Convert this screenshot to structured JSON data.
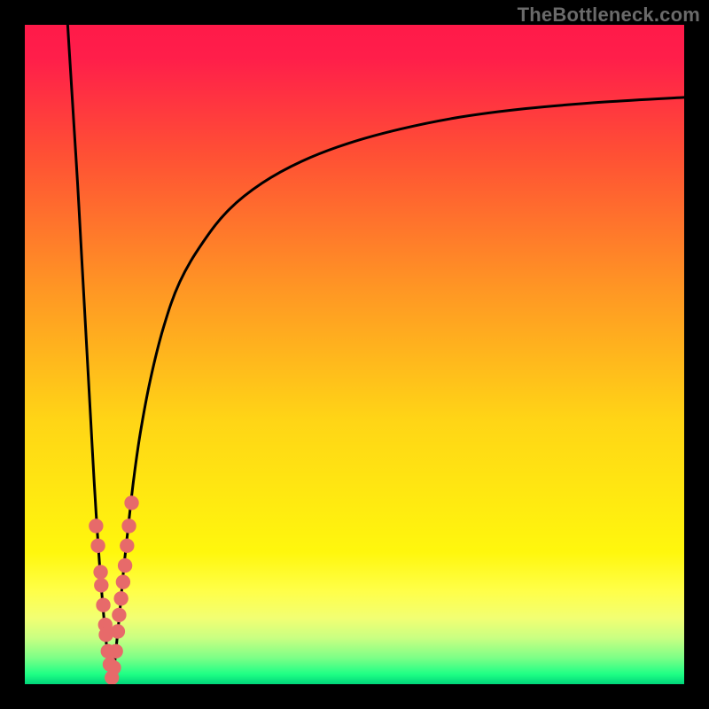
{
  "watermark": "TheBottleneck.com",
  "chart_data": {
    "type": "line",
    "title": "",
    "xlabel": "",
    "ylabel": "",
    "xlim": [
      0,
      100
    ],
    "ylim": [
      0,
      100
    ],
    "grid": false,
    "legend": false,
    "background": {
      "type": "vertical-gradient",
      "stops": [
        {
          "pos": 0.0,
          "color": "#ff1a49"
        },
        {
          "pos": 0.05,
          "color": "#ff1e4a"
        },
        {
          "pos": 0.2,
          "color": "#ff5134"
        },
        {
          "pos": 0.4,
          "color": "#ff9624"
        },
        {
          "pos": 0.6,
          "color": "#ffd516"
        },
        {
          "pos": 0.8,
          "color": "#fff70d"
        },
        {
          "pos": 0.86,
          "color": "#ffff4a"
        },
        {
          "pos": 0.9,
          "color": "#f2ff73"
        },
        {
          "pos": 0.93,
          "color": "#c9ff82"
        },
        {
          "pos": 0.96,
          "color": "#7dff87"
        },
        {
          "pos": 0.985,
          "color": "#1eff85"
        },
        {
          "pos": 1.0,
          "color": "#00d47a"
        }
      ]
    },
    "series": [
      {
        "name": "left-branch",
        "color": "#000000",
        "x": [
          6.5,
          7.0,
          7.5,
          8.0,
          8.5,
          9.0,
          9.5,
          10.0,
          10.5,
          11.0,
          11.5,
          12.0,
          12.5,
          13.0,
          13.2
        ],
        "y": [
          100,
          92,
          84,
          76,
          67,
          58,
          49,
          40,
          31,
          23,
          16,
          10,
          5,
          1.5,
          0.5
        ]
      },
      {
        "name": "right-branch",
        "color": "#000000",
        "x": [
          13.2,
          13.6,
          14.0,
          14.5,
          15.0,
          15.7,
          16.5,
          17.5,
          19.0,
          21.0,
          23.5,
          27.0,
          31.0,
          36.0,
          42.0,
          49.0,
          57.0,
          66.0,
          76.0,
          88.0,
          100.0
        ],
        "y": [
          0.5,
          3.0,
          7.0,
          12.0,
          17.5,
          24.0,
          31.0,
          38.0,
          46.0,
          54.0,
          61.0,
          67.0,
          72.0,
          76.0,
          79.3,
          82.0,
          84.2,
          86.0,
          87.3,
          88.3,
          89.0
        ]
      }
    ],
    "scatter": {
      "name": "marker-dots",
      "color": "#e76a6a",
      "radius": 1.1,
      "points": [
        {
          "x": 10.8,
          "y": 24.0
        },
        {
          "x": 11.1,
          "y": 21.0
        },
        {
          "x": 11.5,
          "y": 17.0
        },
        {
          "x": 11.6,
          "y": 15.0
        },
        {
          "x": 11.9,
          "y": 12.0
        },
        {
          "x": 12.2,
          "y": 9.0
        },
        {
          "x": 12.3,
          "y": 7.5
        },
        {
          "x": 12.6,
          "y": 5.0
        },
        {
          "x": 12.9,
          "y": 3.0
        },
        {
          "x": 13.2,
          "y": 1.0
        },
        {
          "x": 13.5,
          "y": 2.5
        },
        {
          "x": 13.8,
          "y": 5.0
        },
        {
          "x": 14.1,
          "y": 8.0
        },
        {
          "x": 14.3,
          "y": 10.5
        },
        {
          "x": 14.6,
          "y": 13.0
        },
        {
          "x": 14.9,
          "y": 15.5
        },
        {
          "x": 15.2,
          "y": 18.0
        },
        {
          "x": 15.5,
          "y": 21.0
        },
        {
          "x": 15.8,
          "y": 24.0
        },
        {
          "x": 16.2,
          "y": 27.5
        }
      ]
    }
  }
}
